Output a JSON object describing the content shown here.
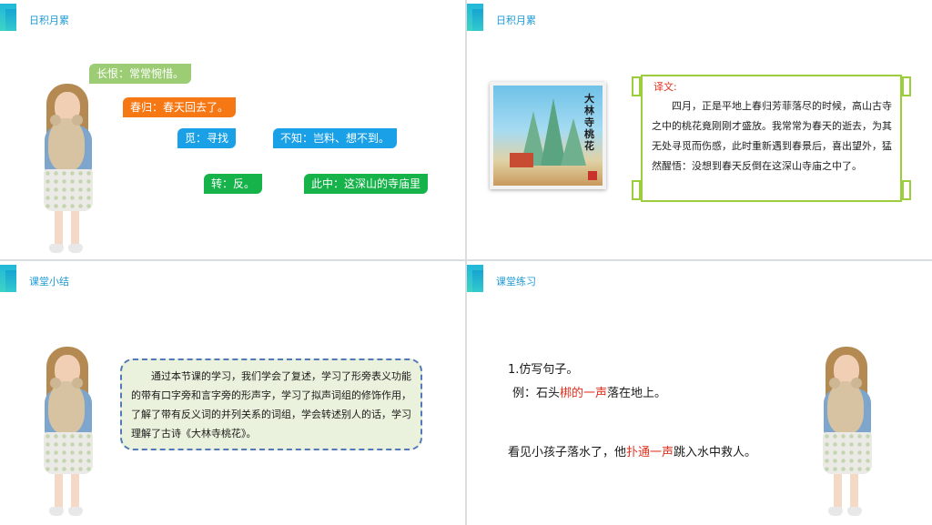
{
  "slides": [
    {
      "title": "日积月累",
      "tags": [
        "长恨：常常惋惜。",
        "春归：春天回去了。",
        "觅：寻找",
        "不知：岂料、想不到。",
        "转：反。",
        "此中：这深山的寺庙里"
      ]
    },
    {
      "title": "日积月累",
      "image_text": "大林寺桃花",
      "translation_label": "译文:",
      "translation_text": "四月，正是平地上春归芳菲落尽的时候，高山古寺之中的桃花竟刚刚才盛放。我常常为春天的逝去，为其无处寻觅而伤感，此时重新遇到春景后，喜出望外，猛然醒悟：没想到春天反倒在这深山寺庙之中了。"
    },
    {
      "title": "课堂小结",
      "summary_text": "通过本节课的学习，我们学会了复述，学习了形旁表义功能的带有口字旁和言字旁的形声字，学习了拟声词组的修饰作用，了解了带有反义词的并列关系的词组，学会转述别人的话，学习理解了古诗《大林寺桃花》。"
    },
    {
      "title": "课堂练习",
      "q_title": "1.仿写句子。",
      "example_prefix": "例：石头",
      "example_highlight": "梆的一声",
      "example_suffix": "落在地上。",
      "sentence_prefix": "看见小孩子落水了，他",
      "sentence_highlight": "扑通一声",
      "sentence_suffix": "跳入水中救人。"
    }
  ],
  "colors": {
    "accent": "#1fb8d9",
    "title": "#1f9bd6",
    "highlight_red": "#e0311e",
    "tag_green_light": "#9ccc74",
    "tag_orange": "#f57815",
    "tag_blue": "#1aa0e6",
    "tag_green": "#16b24a",
    "frame_green": "#9ccd3a",
    "dashed_blue": "#5479b8"
  }
}
